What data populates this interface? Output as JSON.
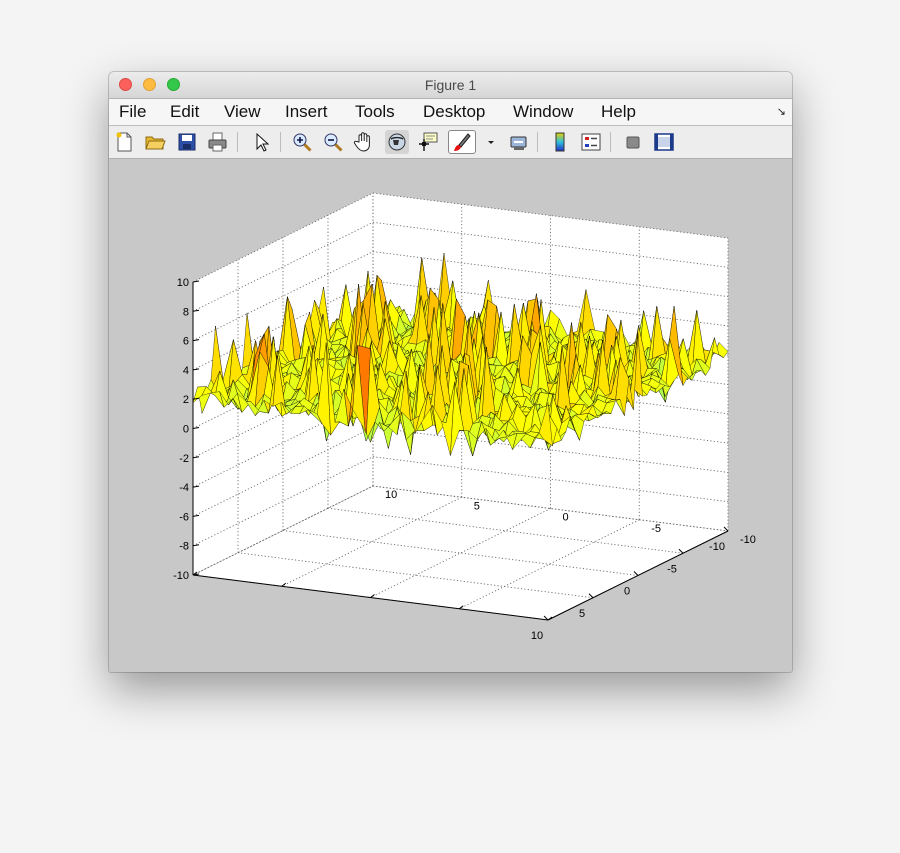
{
  "window": {
    "title": "Figure 1"
  },
  "menu": {
    "items": [
      "File",
      "Edit",
      "View",
      "Insert",
      "Tools",
      "Desktop",
      "Window",
      "Help"
    ]
  },
  "toolbar": {
    "buttons": [
      {
        "name": "new-figure",
        "icon": "new-document-icon"
      },
      {
        "name": "open-file",
        "icon": "folder-open-icon"
      },
      {
        "name": "save-figure",
        "icon": "floppy-disk-icon"
      },
      {
        "name": "print-figure",
        "icon": "printer-icon"
      },
      {
        "name": "edit-plot",
        "icon": "arrow-pointer-icon"
      },
      {
        "name": "zoom-in",
        "icon": "zoom-in-icon"
      },
      {
        "name": "zoom-out",
        "icon": "zoom-out-icon"
      },
      {
        "name": "pan",
        "icon": "hand-icon"
      },
      {
        "name": "rotate-3d",
        "icon": "rotate-3d-icon",
        "active": true
      },
      {
        "name": "data-cursor",
        "icon": "data-cursor-icon"
      },
      {
        "name": "brush",
        "icon": "brush-icon",
        "active": true
      },
      {
        "name": "link-plot",
        "icon": "link-plot-icon"
      },
      {
        "name": "insert-colorbar",
        "icon": "colorbar-icon"
      },
      {
        "name": "insert-legend",
        "icon": "legend-icon"
      },
      {
        "name": "hide-plot-tools",
        "icon": "hide-tools-icon"
      },
      {
        "name": "show-plot-tools",
        "icon": "show-tools-icon"
      }
    ]
  },
  "chart_data": {
    "type": "surface",
    "title": "",
    "xlabel": "",
    "ylabel": "",
    "zlabel": "",
    "xlim": [
      -10,
      10
    ],
    "ylim": [
      -10,
      10
    ],
    "zlim": [
      -10,
      10
    ],
    "x_ticks": [
      10,
      5,
      0,
      -5,
      -10
    ],
    "y_ticks": [
      -10,
      -5,
      0,
      5,
      10
    ],
    "z_ticks": [
      -10,
      -8,
      -6,
      -4,
      -2,
      0,
      2,
      4,
      6,
      8,
      10
    ],
    "grid": true,
    "colormap": "jet",
    "surface_z_range": [
      -2,
      8
    ],
    "surface_mean_z": 2,
    "colors": {
      "axes_background": "#ffffff",
      "figure_background": "#c8c8c8",
      "surface_low": "#00006a",
      "surface_mid": "#0030d0",
      "surface_high": "#00e8e8"
    }
  }
}
